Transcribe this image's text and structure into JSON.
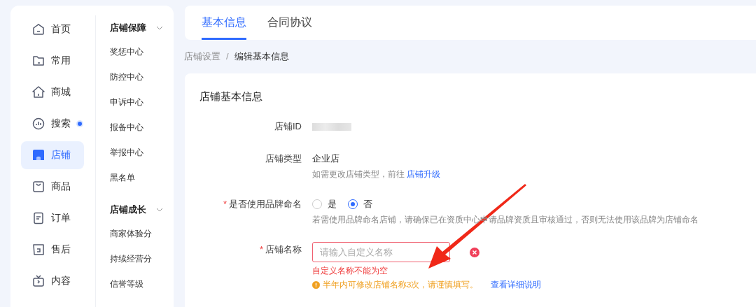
{
  "sidebar": {
    "nav": [
      {
        "label": "首页",
        "selected": false,
        "dot": false
      },
      {
        "label": "常用",
        "selected": false,
        "dot": false
      },
      {
        "label": "商城",
        "selected": false,
        "dot": false
      },
      {
        "label": "搜索",
        "selected": false,
        "dot": true
      },
      {
        "label": "店铺",
        "selected": true,
        "dot": false
      },
      {
        "label": "商品",
        "selected": false,
        "dot": false
      },
      {
        "label": "订单",
        "selected": false,
        "dot": false
      },
      {
        "label": "售后",
        "selected": false,
        "dot": false
      },
      {
        "label": "内容",
        "selected": false,
        "dot": false
      }
    ],
    "groups": [
      {
        "title": "店铺保障",
        "expanded": true,
        "items": [
          "奖惩中心",
          "防控中心",
          "申诉中心",
          "报备中心",
          "举报中心",
          "黑名单"
        ]
      },
      {
        "title": "店铺成长",
        "expanded": true,
        "items": [
          "商家体验分",
          "持续经营分",
          "信誉等级"
        ]
      }
    ]
  },
  "tabs": [
    {
      "label": "基本信息",
      "selected": true
    },
    {
      "label": "合同协议",
      "selected": false
    }
  ],
  "breadcrumb": {
    "items": [
      "店铺设置",
      "编辑基本信息"
    ],
    "separator": "/"
  },
  "form": {
    "title": "店铺基本信息",
    "rows": [
      {
        "kind": "redacted",
        "label": "店铺ID"
      },
      {
        "kind": "text",
        "label": "店铺类型",
        "value": "企业店",
        "hint": "如需更改店铺类型，前往",
        "hint_link": "店铺升级"
      },
      {
        "kind": "radio",
        "label": "是否使用品牌命名",
        "required_mark": "*",
        "options": [
          {
            "label": "是",
            "selected": false
          },
          {
            "label": "否",
            "selected": true
          }
        ],
        "hint": "若需使用品牌命名店铺，请确保已在资质中心申请品牌资质且审核通过，否则无法使用该品牌为店铺命名"
      },
      {
        "kind": "input",
        "label": "店铺名称",
        "required_mark": "*",
        "placeholder": "请输入自定义名称",
        "error": true,
        "error_text": "自定义名称不能为空",
        "warning": "半年内可修改店铺名称3次，请谨慎填写。",
        "warning_link": "查看详细说明"
      }
    ]
  }
}
